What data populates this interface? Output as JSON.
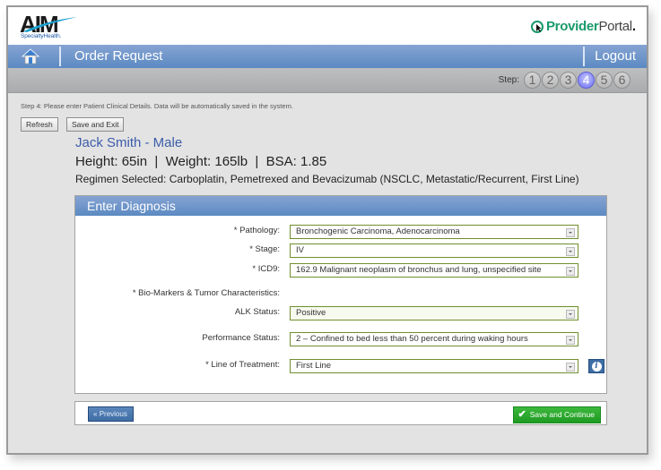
{
  "header": {
    "logo_text": "AIM",
    "logo_subtext": "SpecialtyHealth.",
    "portal_bold": "Provider",
    "portal_light": "Portal",
    "portal_dot": "."
  },
  "navbar": {
    "title": "Order Request",
    "logout_label": "Logout"
  },
  "steps": {
    "label": "Step:",
    "items": [
      "1",
      "2",
      "3",
      "4",
      "5",
      "6"
    ],
    "active": "4"
  },
  "instruction": "Step 4: Please enter Patient Clinical Details. Data will be automatically saved in the system.",
  "toolbar": {
    "refresh_label": "Refresh",
    "save_exit_label": "Save and Exit"
  },
  "patient": {
    "name_line": "Jack Smith - Male",
    "vitals_line": "Height: 65in  |  Weight: 165lb  |  BSA: 1.85",
    "regimen_line": "Regimen Selected: Carboplatin, Pemetrexed and Bevacizumab (NSCLC, Metastatic/Recurrent, First Line)"
  },
  "diagnosis": {
    "title": "Enter Diagnosis",
    "fields": [
      {
        "label": "* Pathology:",
        "value": "Bronchogenic Carcinoma, Adenocarcinoma"
      },
      {
        "label": "* Stage:",
        "value": "IV"
      },
      {
        "label": "* ICD9:",
        "value": "162.9 Malignant neoplasm of bronchus and lung, unspecified site"
      }
    ],
    "biomarkers_label": "* Bio-Markers & Tumor Characteristics:",
    "biomarker_fields": [
      {
        "label": "ALK Status:",
        "value": "Positive"
      },
      {
        "label": "Performance Status:",
        "value": "2 – Confined to bed less than 50 percent during waking hours"
      },
      {
        "label": "* Line of Treatment:",
        "value": "First Line"
      }
    ],
    "info_icon": "i"
  },
  "footer": {
    "previous_label": "Previous",
    "previous_icon": "«",
    "save_continue_label": "Save and Continue",
    "save_continue_icon": "✔"
  },
  "colors": {
    "nav_blue": "#5b8ac2",
    "link_blue": "#3c5ca9",
    "field_border_green": "#6f8f2f",
    "save_green": "#1f9a22",
    "portal_green": "#1a9a6c",
    "active_step": "#6b6df0"
  }
}
